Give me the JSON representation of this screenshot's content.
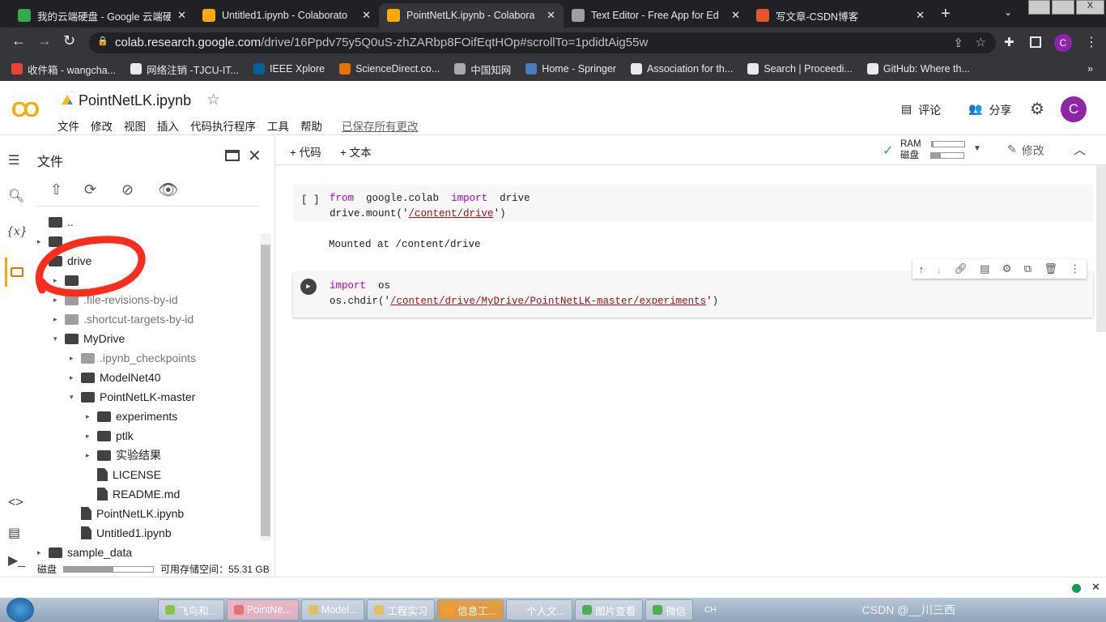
{
  "browser": {
    "tabs": [
      {
        "title": "我的云端硬盘 - Google 云端硬",
        "icon": "google-drive-icon",
        "color": "#34a853"
      },
      {
        "title": "Untitled1.ipynb - Colaborato",
        "icon": "colab-icon",
        "color": "#f9ab00"
      },
      {
        "title": "PointNetLK.ipynb - Colabora",
        "icon": "colab-icon",
        "color": "#f9ab00",
        "active": true
      },
      {
        "title": "Text Editor - Free App for Ed",
        "icon": "text-editor-icon",
        "color": "#9aa0a6"
      },
      {
        "title": "写文章-CSDN博客",
        "icon": "csdn-icon",
        "color": "#e8532f"
      }
    ],
    "url_host": "colab.research.google.com",
    "url_path": "/drive/16Ppdv75y5Q0uS-zhZARbp8FOifEqtHOp#scrollTo=1pdidtAig55w",
    "profile": "C",
    "bookmarks": [
      "收件箱 - wangcha...",
      "网络注销 -TJCU-IT...",
      "IEEE Xplore",
      "ScienceDirect.co...",
      "中国知网",
      "Home - Springer",
      "Association for th...",
      "Search | Proceedi...",
      "GitHub: Where th..."
    ],
    "more_bookmarks": "»"
  },
  "colab": {
    "notebook_title": "PointNetLK.ipynb",
    "menu": [
      "文件",
      "修改",
      "视图",
      "插入",
      "代码执行程序",
      "工具",
      "帮助"
    ],
    "save_status": "已保存所有更改",
    "comment": "评论",
    "share": "分享",
    "avatar": "C",
    "add_code": "+ 代码",
    "add_text": "+ 文本",
    "ram_label": "RAM",
    "disk_label": "磁盘",
    "ram_pct": 5,
    "disk_pct": 30,
    "edit": "修改",
    "accent": "#f9ab00"
  },
  "files": {
    "title": "文件",
    "tree": [
      {
        "label": "..",
        "type": "up",
        "level": 0
      },
      {
        "label": "",
        "type": "folder",
        "level": 0,
        "arrow": "▸"
      },
      {
        "label": "drive",
        "type": "folder",
        "level": 0
      },
      {
        "label": "",
        "type": "folder",
        "level": 1,
        "arrow": "▸"
      },
      {
        "label": ".file-revisions-by-id",
        "type": "folder",
        "level": 1,
        "arrow": "▸",
        "dim": true
      },
      {
        "label": ".shortcut-targets-by-id",
        "type": "folder",
        "level": 1,
        "arrow": "▸",
        "dim": true
      },
      {
        "label": "MyDrive",
        "type": "folder",
        "level": 1,
        "arrow": "▾"
      },
      {
        "label": ".ipynb_checkpoints",
        "type": "folder",
        "level": 2,
        "arrow": "▸",
        "dim": true
      },
      {
        "label": "ModelNet40",
        "type": "folder",
        "level": 2,
        "arrow": "▸"
      },
      {
        "label": "PointNetLK-master",
        "type": "folder",
        "level": 2,
        "arrow": "▾"
      },
      {
        "label": "experiments",
        "type": "folder",
        "level": 3,
        "arrow": "▸"
      },
      {
        "label": "ptlk",
        "type": "folder",
        "level": 3,
        "arrow": "▸"
      },
      {
        "label": "实验结果",
        "type": "folder",
        "level": 3,
        "arrow": "▸"
      },
      {
        "label": "LICENSE",
        "type": "file",
        "level": 3
      },
      {
        "label": "README.md",
        "type": "file",
        "level": 3
      },
      {
        "label": "PointNetLK.ipynb",
        "type": "file",
        "level": 2
      },
      {
        "label": "Untitled1.ipynb",
        "type": "file",
        "level": 2
      },
      {
        "label": "sample_data",
        "type": "folder",
        "level": 0,
        "arrow": "▸"
      }
    ],
    "disk_label": "磁盘",
    "disk_pct": 55,
    "storage": "可用存储空间：55.31 GB"
  },
  "cells": [
    {
      "prompt": "[ ]",
      "lines": [
        [
          "from",
          "google.colab",
          "import",
          "drive"
        ],
        [
          "drive.mount('",
          "/content/drive",
          "')"
        ]
      ],
      "output": "Mounted at /content/drive"
    },
    {
      "lines": [
        [
          "import",
          "os"
        ],
        [
          "os.chdir('",
          "/content/drive/MyDrive/PointNetLK-master/experiments",
          "')"
        ]
      ]
    }
  ],
  "taskbar": {
    "items": [
      "飞鸟和...",
      "PointNe...",
      "Model...",
      "工程实习",
      "信息工...",
      "个人文...",
      "图片查看",
      "微信"
    ],
    "lang": "CH",
    "watermark": "CSDN @__川三西"
  }
}
